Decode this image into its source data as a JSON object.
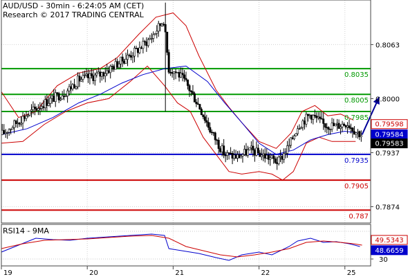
{
  "chart_data": {
    "type": "candlestick",
    "title": "AUD/USD - 30min - 6:24:05 AM (CET)",
    "subtitle": "Research © 2017 TRADING CENTRAL",
    "x_tick_labels": [
      "19",
      "20",
      "21",
      "22",
      "25"
    ],
    "x_tick_positions": [
      0,
      2,
      4,
      6,
      8
    ],
    "x_range": [
      0,
      8.6
    ],
    "y_range": [
      0.7855,
      0.8115
    ],
    "y_tick_labels": [
      "0.8063",
      "0.8000",
      "0.7937",
      "0.7874"
    ],
    "y_ticks": [
      0.8063,
      0.8,
      0.7937,
      0.7874
    ],
    "levels": [
      {
        "label": "0.8035",
        "value": 0.8035,
        "color": "#009900"
      },
      {
        "label": "0.8005",
        "value": 0.8005,
        "color": "#009900"
      },
      {
        "label": "0.7985",
        "value": 0.7985,
        "color": "#009900"
      },
      {
        "label": "0.7935",
        "value": 0.7935,
        "color": "#0000cc"
      },
      {
        "label": "0.7905",
        "value": 0.7905,
        "color": "#cc0000"
      },
      {
        "label": "0.787",
        "value": 0.787,
        "color": "#cc0000"
      }
    ],
    "price_badges": [
      {
        "label": "0.79598",
        "value": 0.79598,
        "color": "#cc0000"
      },
      {
        "label": "0.79584",
        "value": 0.79584,
        "color": "#0000cc"
      },
      {
        "label": "0.79583",
        "value": 0.79583,
        "color": "#000000"
      }
    ],
    "price_path": [
      [
        0.0,
        0.7958
      ],
      [
        0.5,
        0.7978
      ],
      [
        1.0,
        0.7995
      ],
      [
        1.5,
        0.8008
      ],
      [
        1.8,
        0.8022
      ],
      [
        2.3,
        0.8028
      ],
      [
        2.8,
        0.8044
      ],
      [
        3.2,
        0.8058
      ],
      [
        3.5,
        0.8072
      ],
      [
        3.78,
        0.8092
      ],
      [
        3.9,
        0.8035
      ],
      [
        4.1,
        0.803
      ],
      [
        4.3,
        0.8018
      ],
      [
        4.6,
        0.7992
      ],
      [
        4.9,
        0.796
      ],
      [
        5.2,
        0.7935
      ],
      [
        5.5,
        0.7932
      ],
      [
        5.8,
        0.794
      ],
      [
        6.2,
        0.7932
      ],
      [
        6.45,
        0.7926
      ],
      [
        6.7,
        0.7945
      ],
      [
        6.9,
        0.7968
      ],
      [
        7.2,
        0.7982
      ],
      [
        7.5,
        0.797
      ],
      [
        7.8,
        0.7968
      ],
      [
        8.05,
        0.7972
      ],
      [
        8.25,
        0.7962
      ],
      [
        8.4,
        0.7958
      ]
    ],
    "series": [
      {
        "name": "Bollinger upper",
        "color": "#cc0000",
        "points": [
          [
            0.0,
            0.8008
          ],
          [
            0.4,
            0.7978
          ],
          [
            0.8,
            0.7985
          ],
          [
            1.3,
            0.8015
          ],
          [
            1.8,
            0.803
          ],
          [
            2.3,
            0.8035
          ],
          [
            2.7,
            0.8048
          ],
          [
            3.2,
            0.8075
          ],
          [
            3.6,
            0.8095
          ],
          [
            4.0,
            0.81
          ],
          [
            4.3,
            0.8085
          ],
          [
            4.6,
            0.805
          ],
          [
            5.0,
            0.801
          ],
          [
            5.3,
            0.799
          ],
          [
            5.6,
            0.7972
          ],
          [
            6.0,
            0.795
          ],
          [
            6.4,
            0.7942
          ],
          [
            6.75,
            0.796
          ],
          [
            7.0,
            0.7985
          ],
          [
            7.3,
            0.7992
          ],
          [
            7.6,
            0.798
          ],
          [
            7.9,
            0.7982
          ],
          [
            8.2,
            0.7975
          ]
        ]
      },
      {
        "name": "Bollinger lower",
        "color": "#cc0000",
        "points": [
          [
            0.0,
            0.7948
          ],
          [
            0.5,
            0.795
          ],
          [
            1.0,
            0.797
          ],
          [
            1.5,
            0.7985
          ],
          [
            2.0,
            0.7995
          ],
          [
            2.5,
            0.8
          ],
          [
            3.0,
            0.802
          ],
          [
            3.4,
            0.8038
          ],
          [
            3.8,
            0.8015
          ],
          [
            4.1,
            0.7995
          ],
          [
            4.4,
            0.7985
          ],
          [
            4.7,
            0.7955
          ],
          [
            5.0,
            0.7935
          ],
          [
            5.3,
            0.7915
          ],
          [
            5.6,
            0.7912
          ],
          [
            6.0,
            0.7915
          ],
          [
            6.3,
            0.7912
          ],
          [
            6.55,
            0.7905
          ],
          [
            6.8,
            0.7915
          ],
          [
            7.1,
            0.7948
          ],
          [
            7.4,
            0.7955
          ],
          [
            7.7,
            0.795
          ],
          [
            8.0,
            0.795
          ],
          [
            8.25,
            0.795
          ]
        ]
      },
      {
        "name": "Moving average",
        "color": "#0000cc",
        "points": [
          [
            0.0,
            0.7958
          ],
          [
            0.6,
            0.7965
          ],
          [
            1.2,
            0.7978
          ],
          [
            1.8,
            0.7995
          ],
          [
            2.3,
            0.8005
          ],
          [
            2.8,
            0.8018
          ],
          [
            3.3,
            0.8028
          ],
          [
            3.8,
            0.8035
          ],
          [
            4.3,
            0.8038
          ],
          [
            4.8,
            0.802
          ],
          [
            5.2,
            0.7995
          ],
          [
            5.6,
            0.7972
          ],
          [
            6.0,
            0.7948
          ],
          [
            6.4,
            0.7935
          ],
          [
            6.8,
            0.794
          ],
          [
            7.2,
            0.7952
          ],
          [
            7.6,
            0.7958
          ],
          [
            8.0,
            0.7962
          ],
          [
            8.3,
            0.796
          ]
        ]
      }
    ],
    "arrow": {
      "from": [
        8.4,
        0.7958
      ],
      "to": [
        8.8,
        0.8002
      ],
      "color": "#000099"
    },
    "rsi_panel": {
      "title": "RSI14 - 9MA",
      "y_range": [
        20,
        80
      ],
      "y_tick_labels": [
        "30"
      ],
      "y_ticks": [
        30
      ],
      "bands": [
        70,
        30
      ],
      "value_badges": [
        {
          "label": "49.5343",
          "value": 49.5343,
          "color": "#cc0000"
        },
        {
          "label": "48.6659",
          "value": 48.6659,
          "color": "#0000cc"
        }
      ],
      "rsi": [
        [
          0.0,
          40
        ],
        [
          0.4,
          50
        ],
        [
          0.8,
          60
        ],
        [
          1.2,
          58
        ],
        [
          1.6,
          57
        ],
        [
          2.0,
          60
        ],
        [
          2.5,
          62
        ],
        [
          3.0,
          64
        ],
        [
          3.5,
          66
        ],
        [
          3.8,
          64
        ],
        [
          3.9,
          45
        ],
        [
          4.2,
          42
        ],
        [
          4.6,
          38
        ],
        [
          5.0,
          32
        ],
        [
          5.3,
          28
        ],
        [
          5.6,
          36
        ],
        [
          6.0,
          40
        ],
        [
          6.3,
          36
        ],
        [
          6.7,
          48
        ],
        [
          6.9,
          56
        ],
        [
          7.2,
          60
        ],
        [
          7.5,
          54
        ],
        [
          7.8,
          55
        ],
        [
          8.1,
          52
        ],
        [
          8.35,
          48
        ]
      ],
      "rsi_ma": [
        [
          0.0,
          45
        ],
        [
          0.5,
          52
        ],
        [
          1.0,
          57
        ],
        [
          1.5,
          58
        ],
        [
          2.0,
          59
        ],
        [
          2.5,
          61
        ],
        [
          3.0,
          63
        ],
        [
          3.5,
          64
        ],
        [
          3.9,
          60
        ],
        [
          4.3,
          48
        ],
        [
          4.7,
          42
        ],
        [
          5.1,
          36
        ],
        [
          5.5,
          33
        ],
        [
          5.9,
          36
        ],
        [
          6.3,
          40
        ],
        [
          6.7,
          45
        ],
        [
          7.1,
          54
        ],
        [
          7.5,
          56
        ],
        [
          7.9,
          54
        ],
        [
          8.2,
          52
        ],
        [
          8.4,
          50
        ]
      ]
    }
  }
}
